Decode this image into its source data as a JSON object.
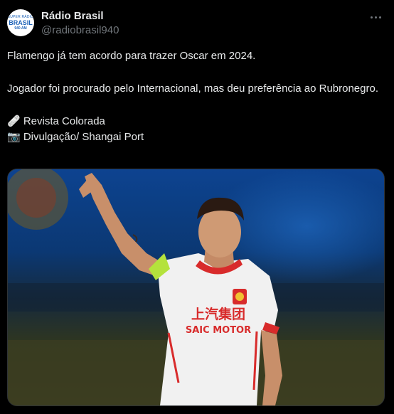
{
  "account": {
    "display_name": "Rádio Brasil",
    "handle": "@radiobrasil940",
    "avatar": {
      "line1": "SUPER RÁDIO",
      "line2": "BRASIL",
      "line3": "940 AM"
    }
  },
  "tweet": {
    "line1": "Flamengo já tem acordo para trazer Oscar em 2024.",
    "line2": "Jogador foi procurado pelo Internacional, mas deu preferência ao Rubronegro.",
    "credit1": "🩹 Revista Colorada",
    "credit2": "📷 Divulgação/ Shangai Port"
  },
  "media": {
    "jersey_chinese": "上汽集团",
    "jersey_sponsor": "SAIC MOTOR"
  },
  "colors": {
    "background": "#000000",
    "text": "#e7e9ea",
    "secondary": "#71767b"
  }
}
